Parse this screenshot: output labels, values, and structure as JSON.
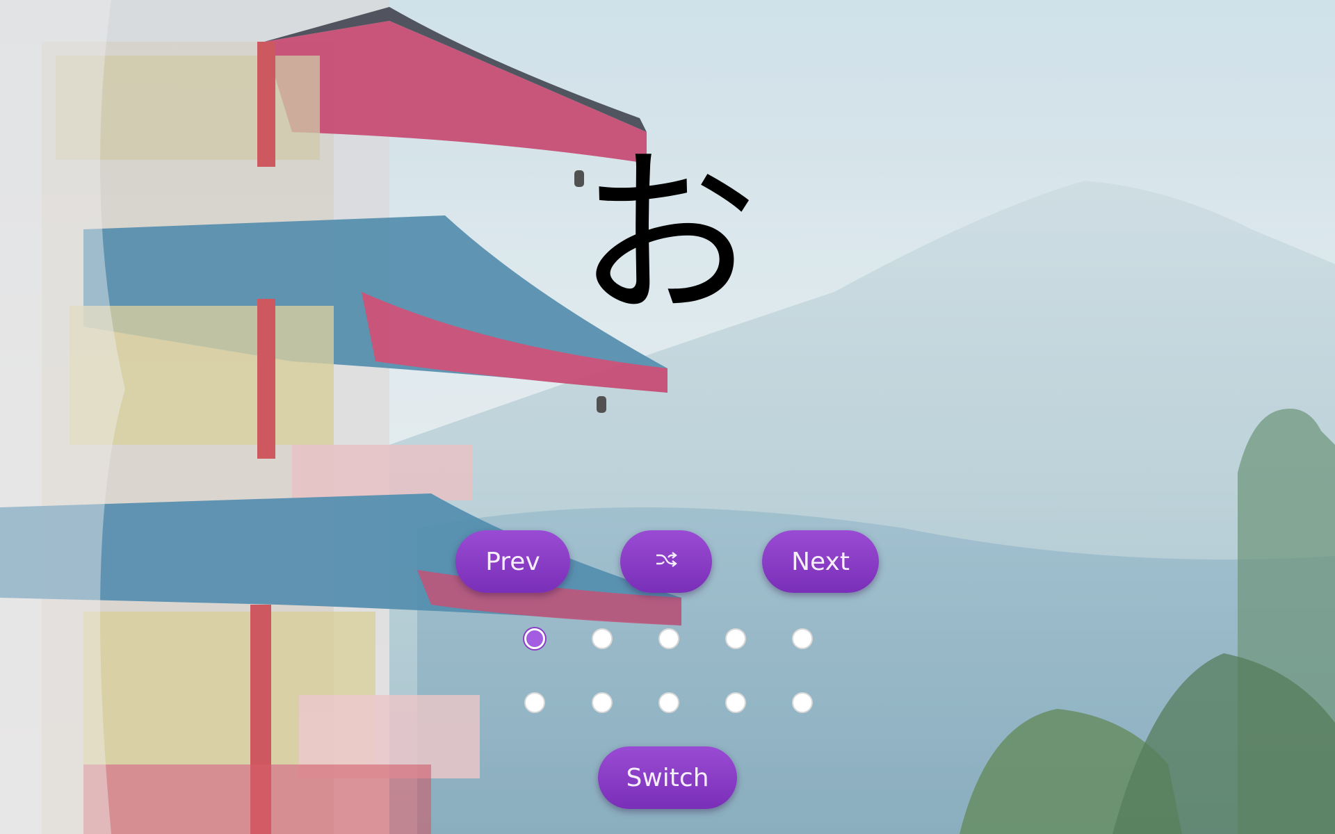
{
  "card": {
    "character": "お"
  },
  "controls": {
    "prev_label": "Prev",
    "shuffle_icon": "shuffle-icon",
    "next_label": "Next",
    "switch_label": "Switch"
  },
  "pagination": {
    "total": 10,
    "active_index": 0
  },
  "colors": {
    "button_purple": "#8a3cc7",
    "button_text": "#f7eefc",
    "active_dot": "#a35de0",
    "inactive_dot": "#ffffff"
  },
  "background": {
    "description_icon": "watercolor-pagoda-mountain-scene"
  }
}
